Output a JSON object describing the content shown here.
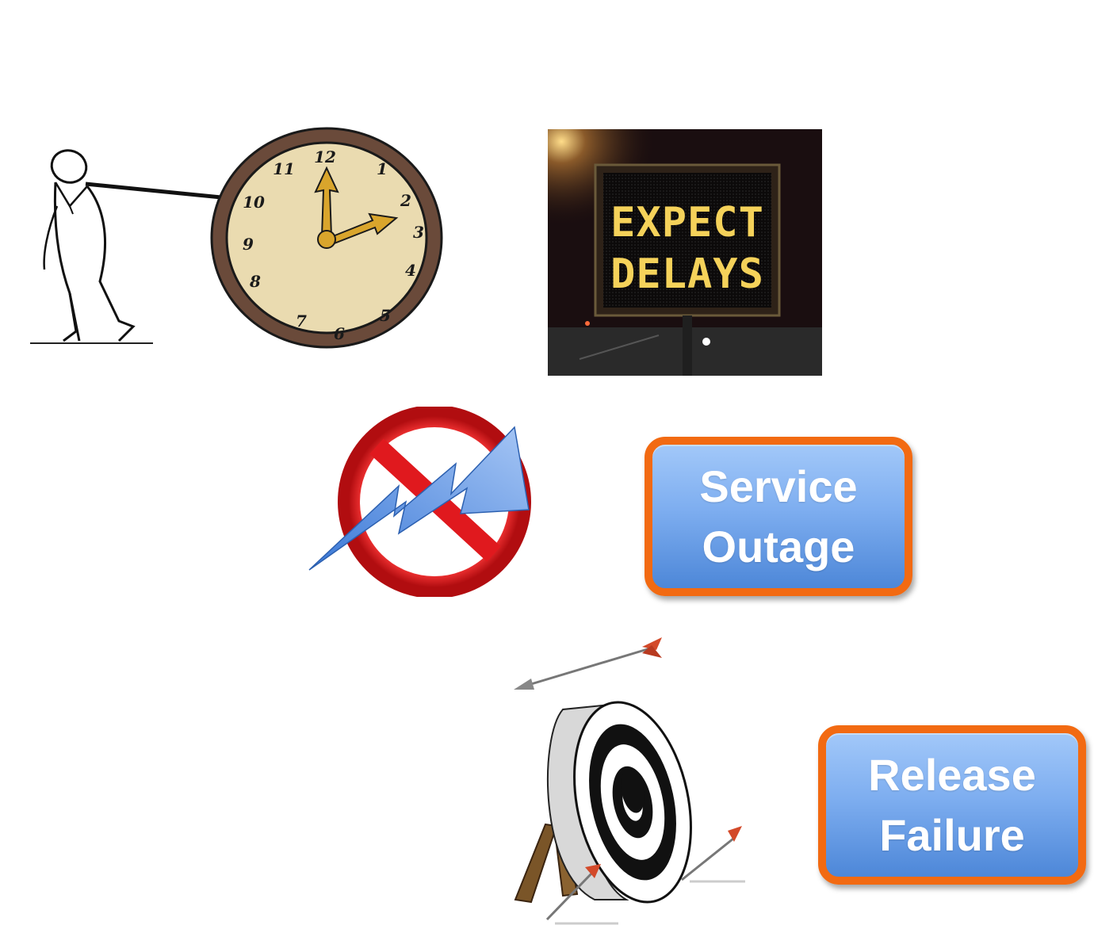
{
  "callouts": {
    "service_outage": {
      "line1": "Service",
      "line2": "Outage"
    },
    "release_failure": {
      "line1": "Release",
      "line2": "Failure"
    }
  },
  "delay_sign": {
    "line1": "EXPECT",
    "line2": "DELAYS"
  },
  "clock": {
    "numerals": [
      "12",
      "1",
      "2",
      "3",
      "4",
      "5",
      "6",
      "7",
      "8",
      "9",
      "10",
      "11"
    ]
  },
  "colors": {
    "callout_border": "#f26a12",
    "callout_fill_top": "#a2c8f9",
    "callout_fill_bottom": "#4d87d8",
    "prohibition_red": "#e0191e",
    "lightning_blue": "#5a92e0",
    "sign_text": "#f5d25a",
    "clock_face": "#eadbb0",
    "clock_rim": "#6a4a3a"
  },
  "icons": [
    "stick-figure-pulling-clock",
    "clock-icon",
    "expect-delays-sign-photo",
    "no-lightning-icon",
    "archery-target-icon"
  ]
}
